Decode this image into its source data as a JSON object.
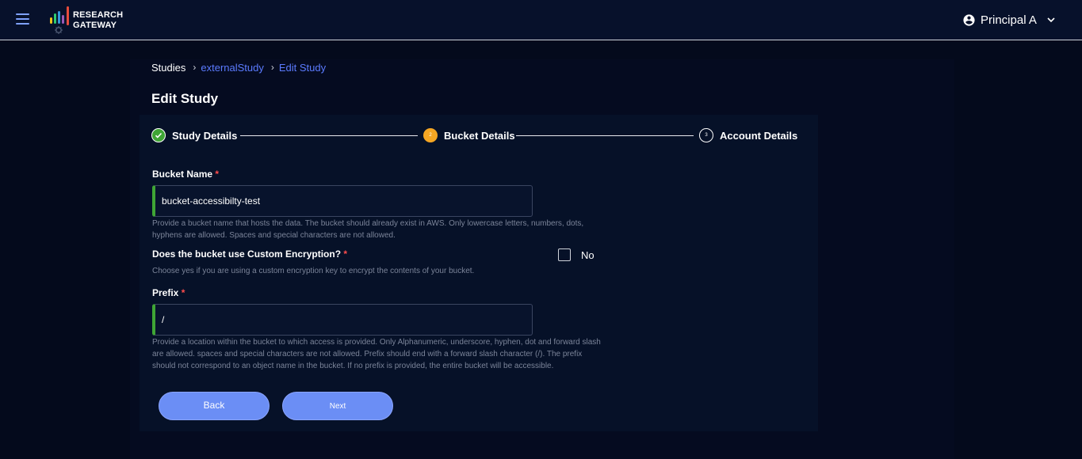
{
  "header": {
    "logo_line1": "RESEARCH",
    "logo_line2": "GATEWAY",
    "user_name": "Principal A",
    "icons": {
      "menu": "hamburger-menu-icon",
      "user": "account-circle-icon",
      "dropdown": "chevron-down-icon"
    }
  },
  "breadcrumb": {
    "items": [
      "Studies",
      "externalStudy",
      "Edit Study"
    ]
  },
  "page": {
    "title": "Edit Study"
  },
  "stepper": {
    "steps": [
      {
        "label": "Study Details",
        "state": "completed",
        "number": "1"
      },
      {
        "label": "Bucket Details",
        "state": "active",
        "number": "2"
      },
      {
        "label": "Account Details",
        "state": "pending",
        "number": "3"
      }
    ]
  },
  "form": {
    "bucket_name": {
      "label": "Bucket Name",
      "required_mark": "*",
      "value": "bucket-accessibilty-test",
      "hint": "Provide a bucket name that hosts the data. The bucket should already exist in AWS. Only lowercase letters, numbers, dots, hyphens are allowed. Spaces and special characters are not allowed."
    },
    "encryption": {
      "label": "Does the bucket use Custom Encryption?",
      "required_mark": "*",
      "checkbox_label": "No",
      "checked": false,
      "hint": "Choose yes if you are using a custom encryption key to encrypt the contents of your bucket."
    },
    "prefix": {
      "label": "Prefix",
      "required_mark": "*",
      "value": "/",
      "hint": "Provide a location within the bucket to which access is provided. Only Alphanumeric, underscore, hyphen, dot and forward slash are allowed. spaces and special characters are not allowed. Prefix should end with a forward slash character (/). The prefix should not correspond to an object name in the bucket. If no prefix is provided, the entire bucket will be accessible."
    }
  },
  "actions": {
    "back_label": "Back",
    "next_label": "Next"
  },
  "colors": {
    "background": "#040a1c",
    "header": "#07112b",
    "accent": "#6b8ef5",
    "link": "#5b7bff",
    "step_complete": "#3fa535",
    "step_active": "#f5a623",
    "input_valid": "#3fa535",
    "required": "#ff4d4d"
  }
}
